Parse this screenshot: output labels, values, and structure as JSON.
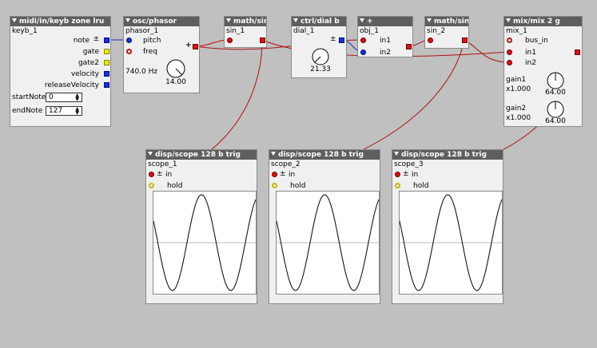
{
  "objects": {
    "keyb": {
      "type": "midi/in/keyb zone lru",
      "name": "keyb_1",
      "outputs": [
        "note",
        "gate",
        "gate2",
        "velocity",
        "releaseVelocity"
      ],
      "pm": "±",
      "start_label": "startNote",
      "start_value": "0",
      "end_label": "endNote",
      "end_value": "127"
    },
    "phasor": {
      "type": "osc/phasor",
      "name": "phasor_1",
      "in_pitch": "pitch",
      "in_freq": "freq",
      "freq_readout": "740.0 Hz",
      "dial_value": "14.00",
      "plus": "+"
    },
    "sin1": {
      "type": "math/sin",
      "name": "sin_1"
    },
    "dial": {
      "type": "ctrl/dial b",
      "name": "dial_1",
      "value": "21.33",
      "pm": "±"
    },
    "plus": {
      "type": "+",
      "name": "obj_1",
      "in1": "in1",
      "in2": "in2"
    },
    "sin2": {
      "type": "math/sin",
      "name": "sin_2"
    },
    "mix": {
      "type": "mix/mix 2 g",
      "name": "mix_1",
      "bus_in": "bus_in",
      "in1": "in1",
      "in2": "in2",
      "gain1": "gain1",
      "gain1_x": "x1.000",
      "gain1_value": "64.00",
      "gain2": "gain2",
      "gain2_x": "x1.000",
      "gain2_value": "64.00"
    },
    "scope1": {
      "type": "disp/scope 128 b trig",
      "name": "scope_1",
      "in": "in",
      "pm": "±",
      "hold": "hold"
    },
    "scope2": {
      "type": "disp/scope 128 b trig",
      "name": "scope_2",
      "in": "in",
      "pm": "±",
      "hold": "hold"
    },
    "scope3": {
      "type": "disp/scope 128 b trig",
      "name": "scope_3",
      "in": "in",
      "pm": "±",
      "hold": "hold"
    }
  },
  "colors": {
    "canvas": "#c0c0c0",
    "header": "#5e5e5e",
    "wire_red": "#b01010",
    "wire_blue": "#2030c0",
    "port_red": "#e01010",
    "port_blue": "#1a2ee0"
  }
}
